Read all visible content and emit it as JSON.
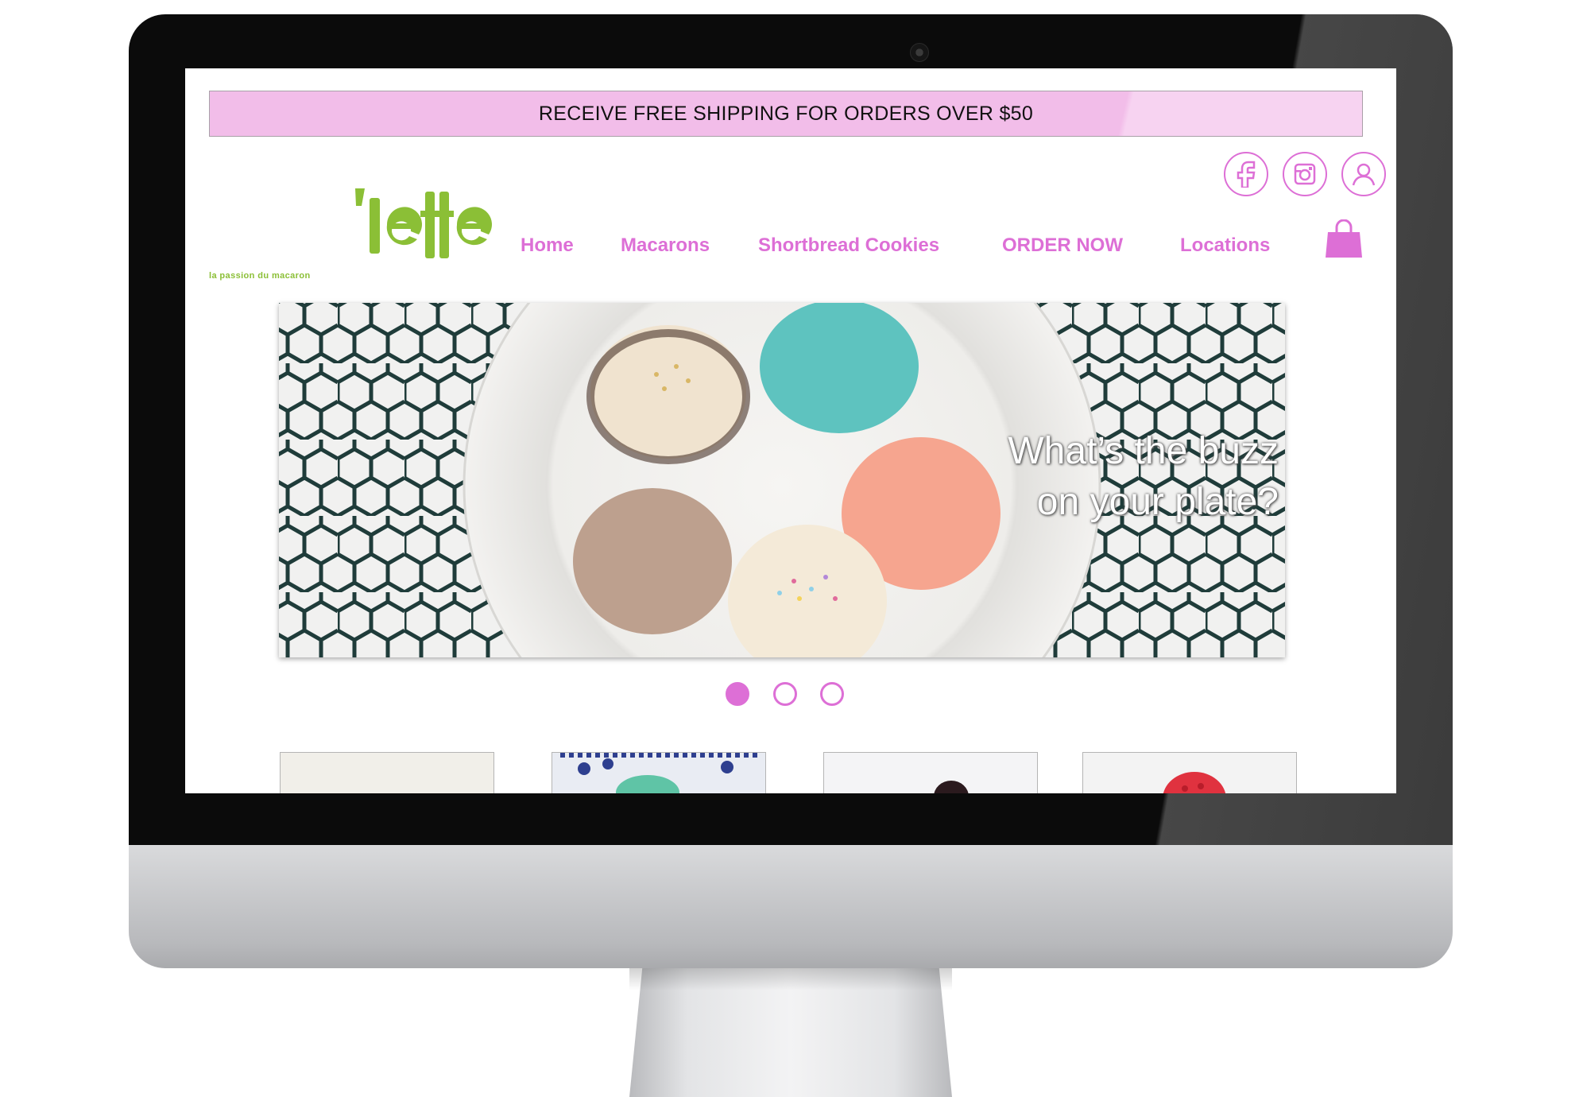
{
  "promo_banner": {
    "text": "RECEIVE FREE SHIPPING FOR ORDERS OVER $50"
  },
  "logo": {
    "tagline": "la passion du macaron",
    "wordmark": "'lette",
    "color": "#8bbf36"
  },
  "social": [
    {
      "name": "facebook-icon"
    },
    {
      "name": "instagram-icon"
    },
    {
      "name": "account-icon"
    }
  ],
  "nav": {
    "items": [
      {
        "label": "Home"
      },
      {
        "label": "Macarons"
      },
      {
        "label": "Shortbread Cookies"
      },
      {
        "label": "ORDER NOW"
      },
      {
        "label": "Locations"
      }
    ],
    "cart_icon": "shopping-bag-icon"
  },
  "hero": {
    "caption_line1": "What’s the buzz",
    "caption_line2": "on your plate?"
  },
  "carousel": {
    "slides": 3,
    "active": 1
  },
  "colors": {
    "accent": "#dd6fd6",
    "banner": "#f2bde9",
    "logo_green": "#8bbf36"
  }
}
